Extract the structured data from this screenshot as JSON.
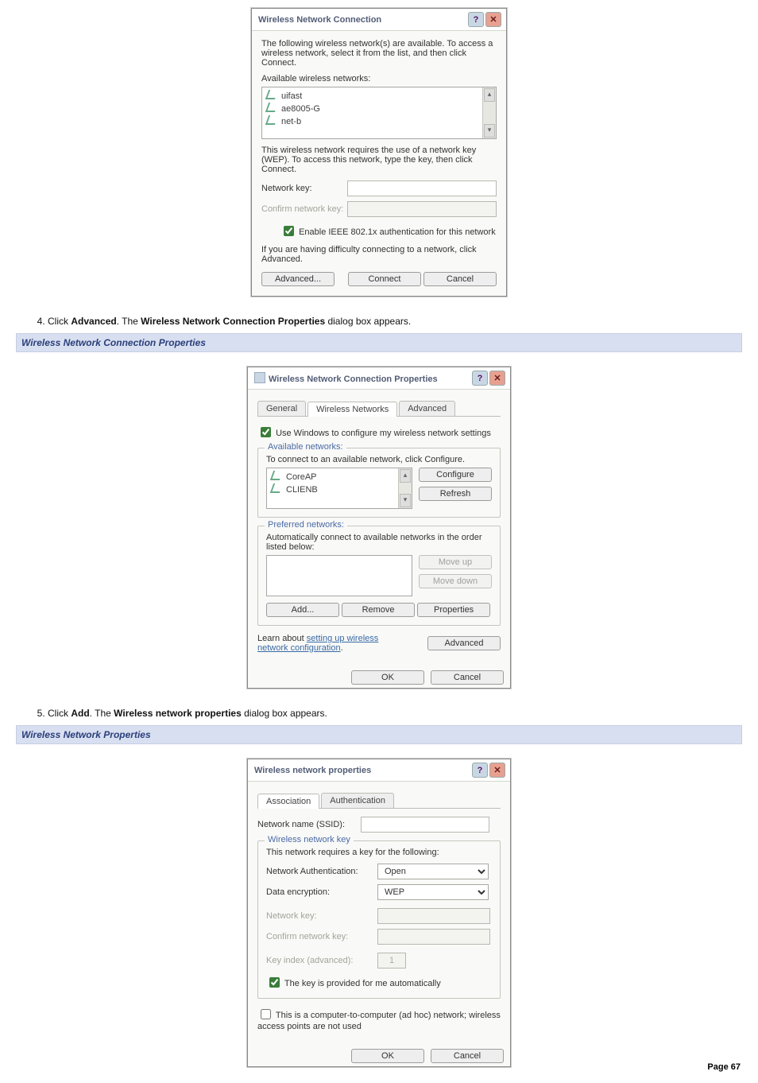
{
  "page_number": "Page 67",
  "dialog1": {
    "title": "Wireless Network Connection",
    "intro": "The following wireless network(s) are available. To access a wireless network, select it from the list, and then click Connect.",
    "avail_label": "Available wireless networks:",
    "networks": [
      "uifast",
      "ae8005-G",
      "net-b"
    ],
    "wep_note": "This wireless network requires the use of a network key (WEP). To access this network, type the key, then click Connect.",
    "netkey_label": "Network key:",
    "confirm_label": "Confirm network key:",
    "chk_label": "Enable IEEE 802.1x authentication for this network",
    "adv_note": "If you are having difficulty connecting to a network, click Advanced.",
    "btn_adv": "Advanced...",
    "btn_connect": "Connect",
    "btn_cancel": "Cancel"
  },
  "step4": {
    "prefix": "Click ",
    "bold1": "Advanced",
    "mid": ". The ",
    "bold2": "Wireless Network Connection Properties",
    "suffix": " dialog box appears."
  },
  "section2_title": "Wireless Network Connection Properties",
  "dialog2": {
    "title": "Wireless Network Connection Properties",
    "tab_general": "General",
    "tab_wireless": "Wireless Networks",
    "tab_adv": "Advanced",
    "chk_usewin": "Use Windows to configure my wireless network settings",
    "avail_legend": "Available networks:",
    "avail_text": "To connect to an available network, click Configure.",
    "avail_items": [
      "CoreAP",
      "CLIENB"
    ],
    "btn_configure": "Configure",
    "btn_refresh": "Refresh",
    "pref_legend": "Preferred networks:",
    "pref_text": "Automatically connect to available networks in the order listed below:",
    "btn_moveup": "Move up",
    "btn_movedown": "Move down",
    "btn_add": "Add...",
    "btn_remove": "Remove",
    "btn_props": "Properties",
    "learn_prefix": "Learn about ",
    "learn_link": "setting up wireless network configuration",
    "btn_adv": "Advanced",
    "btn_ok": "OK",
    "btn_cancel": "Cancel"
  },
  "step5": {
    "prefix": "Click ",
    "bold1": "Add",
    "mid": ". The ",
    "bold2": "Wireless network properties",
    "suffix": " dialog box appears."
  },
  "section3_title": "Wireless Network Properties",
  "dialog3": {
    "title": "Wireless network properties",
    "tab_assoc": "Association",
    "tab_auth": "Authentication",
    "ssid_label": "Network name (SSID):",
    "wnk_legend": "Wireless network key",
    "req_text": "This network requires a key for the following:",
    "auth_label": "Network Authentication:",
    "auth_value": "Open",
    "enc_label": "Data encryption:",
    "enc_value": "WEP",
    "nk_label": "Network key:",
    "cnk_label": "Confirm network key:",
    "idx_label": "Key index (advanced):",
    "idx_value": "1",
    "chk_auto": "The key is provided for me automatically",
    "chk_adhoc": "This is a computer-to-computer (ad hoc) network; wireless access points are not used",
    "btn_ok": "OK",
    "btn_cancel": "Cancel"
  }
}
